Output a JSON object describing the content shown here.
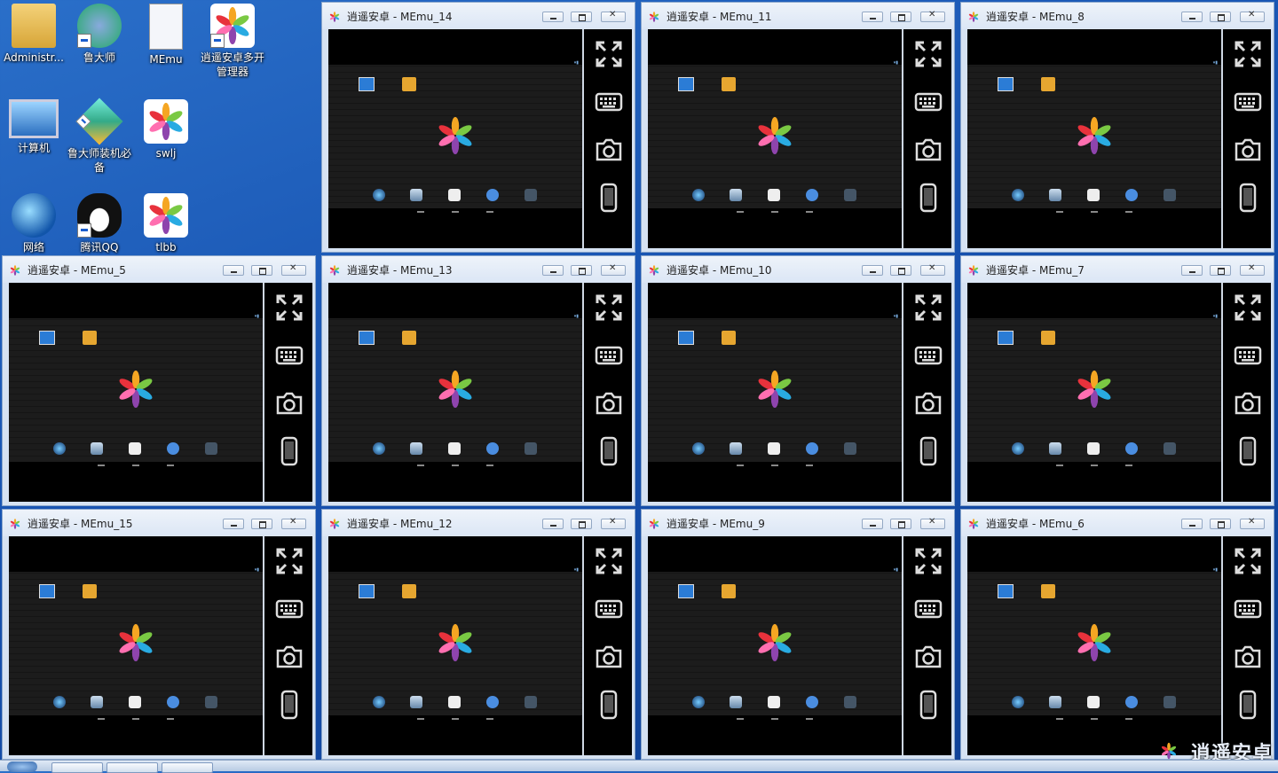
{
  "desktop": {
    "icons": [
      {
        "label": "Administr...",
        "icon": "user-folder-icon"
      },
      {
        "label": "鲁大师",
        "icon": "ludashi-icon"
      },
      {
        "label": "MEmu",
        "icon": "memu-file-icon"
      },
      {
        "label": "逍遥安卓多开管理器",
        "icon": "memu-logo-icon"
      },
      {
        "label": "计算机",
        "icon": "computer-icon"
      },
      {
        "label": "鲁大师装机必备",
        "icon": "cube-icon"
      },
      {
        "label": "swlj",
        "icon": "memu-logo-icon"
      },
      {
        "label": "网络",
        "icon": "network-icon"
      },
      {
        "label": "腾讯QQ",
        "icon": "qq-penguin-icon"
      },
      {
        "label": "tlbb",
        "icon": "memu-logo-icon"
      }
    ]
  },
  "windows": [
    {
      "title": "逍遥安卓 - MEmu_14"
    },
    {
      "title": "逍遥安卓 - MEmu_11"
    },
    {
      "title": "逍遥安卓 - MEmu_8"
    },
    {
      "title": "逍遥安卓 - MEmu_5"
    },
    {
      "title": "逍遥安卓 - MEmu_13"
    },
    {
      "title": "逍遥安卓 - MEmu_10"
    },
    {
      "title": "逍遥安卓 - MEmu_7"
    },
    {
      "title": "逍遥安卓 - MEmu_15"
    },
    {
      "title": "逍遥安卓 - MEmu_12"
    },
    {
      "title": "逍遥安卓 - MEmu_9"
    },
    {
      "title": "逍遥安卓 - MEmu_6"
    }
  ],
  "sidebar_buttons": [
    "fullscreen-icon",
    "keyboard-icon",
    "camera-icon",
    "phone-icon"
  ],
  "watermark": "逍遥安卓",
  "colors": {
    "desktop": "#1752b0",
    "titlebar": "#dbe6f5",
    "screen": "#000000"
  }
}
